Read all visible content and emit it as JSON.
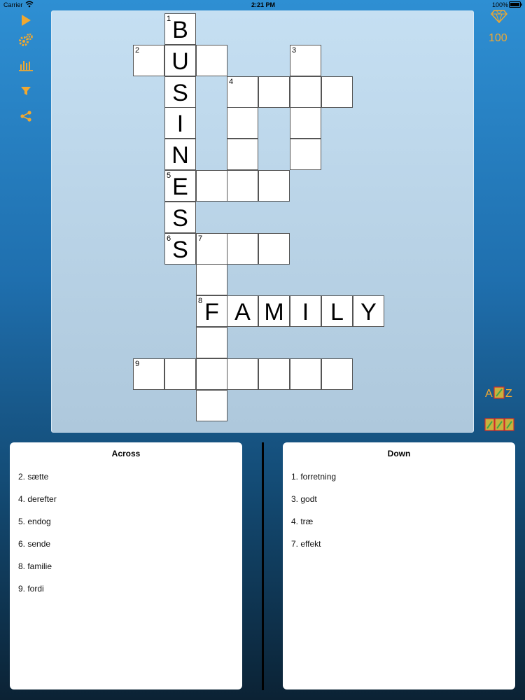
{
  "status": {
    "carrier": "Carrier",
    "time": "2:21 PM",
    "battery": "100%"
  },
  "toolbar": [
    {
      "icon": "play-icon"
    },
    {
      "icon": "settings-gears-icon"
    },
    {
      "icon": "stats-chart-icon"
    },
    {
      "icon": "filter-icon"
    },
    {
      "icon": "share-icon"
    }
  ],
  "score": "100",
  "accent_color": "#f0a830",
  "az_button": {
    "a": "A",
    "z": "Z"
  },
  "across": {
    "title": "Across",
    "clues": [
      "2. sætte",
      "4. derefter",
      "5. endog",
      "6. sende",
      "8. familie",
      "9. fordi"
    ]
  },
  "down": {
    "title": "Down",
    "clues": [
      "1. forretning",
      "3. godt",
      "4. træ",
      "7. effekt"
    ]
  },
  "grid": {
    "cells": [
      {
        "r": 0,
        "c": 3,
        "letter": "B",
        "num": "1"
      },
      {
        "r": 1,
        "c": 2,
        "letter": "",
        "num": "2"
      },
      {
        "r": 1,
        "c": 3,
        "letter": "U",
        "num": ""
      },
      {
        "r": 1,
        "c": 4,
        "letter": "",
        "num": ""
      },
      {
        "r": 1,
        "c": 7,
        "letter": "",
        "num": "3"
      },
      {
        "r": 2,
        "c": 3,
        "letter": "S",
        "num": ""
      },
      {
        "r": 2,
        "c": 5,
        "letter": "",
        "num": "4"
      },
      {
        "r": 2,
        "c": 6,
        "letter": "",
        "num": ""
      },
      {
        "r": 2,
        "c": 7,
        "letter": "",
        "num": ""
      },
      {
        "r": 2,
        "c": 8,
        "letter": "",
        "num": ""
      },
      {
        "r": 3,
        "c": 3,
        "letter": "I",
        "num": ""
      },
      {
        "r": 3,
        "c": 5,
        "letter": "",
        "num": ""
      },
      {
        "r": 3,
        "c": 7,
        "letter": "",
        "num": ""
      },
      {
        "r": 4,
        "c": 3,
        "letter": "N",
        "num": ""
      },
      {
        "r": 4,
        "c": 5,
        "letter": "",
        "num": ""
      },
      {
        "r": 4,
        "c": 7,
        "letter": "",
        "num": ""
      },
      {
        "r": 5,
        "c": 3,
        "letter": "E",
        "num": "5"
      },
      {
        "r": 5,
        "c": 4,
        "letter": "",
        "num": ""
      },
      {
        "r": 5,
        "c": 5,
        "letter": "",
        "num": ""
      },
      {
        "r": 5,
        "c": 6,
        "letter": "",
        "num": ""
      },
      {
        "r": 6,
        "c": 3,
        "letter": "S",
        "num": ""
      },
      {
        "r": 7,
        "c": 3,
        "letter": "S",
        "num": "6"
      },
      {
        "r": 7,
        "c": 4,
        "letter": "",
        "num": "7"
      },
      {
        "r": 7,
        "c": 5,
        "letter": "",
        "num": ""
      },
      {
        "r": 7,
        "c": 6,
        "letter": "",
        "num": ""
      },
      {
        "r": 8,
        "c": 4,
        "letter": "",
        "num": ""
      },
      {
        "r": 9,
        "c": 4,
        "letter": "F",
        "num": "8"
      },
      {
        "r": 9,
        "c": 5,
        "letter": "A",
        "num": ""
      },
      {
        "r": 9,
        "c": 6,
        "letter": "M",
        "num": ""
      },
      {
        "r": 9,
        "c": 7,
        "letter": "I",
        "num": ""
      },
      {
        "r": 9,
        "c": 8,
        "letter": "L",
        "num": ""
      },
      {
        "r": 9,
        "c": 9,
        "letter": "Y",
        "num": ""
      },
      {
        "r": 10,
        "c": 4,
        "letter": "",
        "num": ""
      },
      {
        "r": 11,
        "c": 2,
        "letter": "",
        "num": "9"
      },
      {
        "r": 11,
        "c": 3,
        "letter": "",
        "num": ""
      },
      {
        "r": 11,
        "c": 4,
        "letter": "",
        "num": ""
      },
      {
        "r": 11,
        "c": 5,
        "letter": "",
        "num": ""
      },
      {
        "r": 11,
        "c": 6,
        "letter": "",
        "num": ""
      },
      {
        "r": 11,
        "c": 7,
        "letter": "",
        "num": ""
      },
      {
        "r": 11,
        "c": 8,
        "letter": "",
        "num": ""
      },
      {
        "r": 12,
        "c": 4,
        "letter": "",
        "num": ""
      }
    ]
  }
}
